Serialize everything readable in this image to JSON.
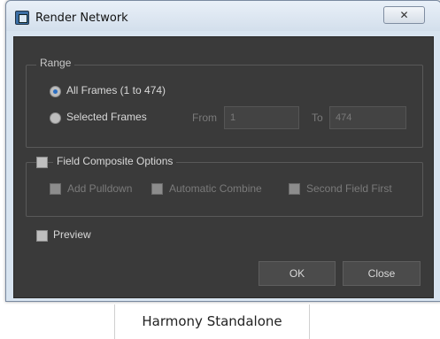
{
  "window": {
    "title": "Render Network",
    "close_glyph": "✕"
  },
  "range": {
    "legend": "Range",
    "all_frames_label": "All Frames (1 to 474)",
    "selected_frames_label": "Selected Frames",
    "selected_option": "all_frames",
    "from_label": "From",
    "from_value": "1",
    "to_label": "To",
    "to_value": "474"
  },
  "field_composite": {
    "label": "Field Composite Options",
    "checked": false,
    "add_pulldown_label": "Add Pulldown",
    "automatic_combine_label": "Automatic Combine",
    "second_field_first_label": "Second Field First"
  },
  "preview": {
    "label": "Preview",
    "checked": false
  },
  "buttons": {
    "ok_label": "OK",
    "close_label": "Close"
  },
  "taskbar": {
    "label": "Harmony Standalone"
  }
}
